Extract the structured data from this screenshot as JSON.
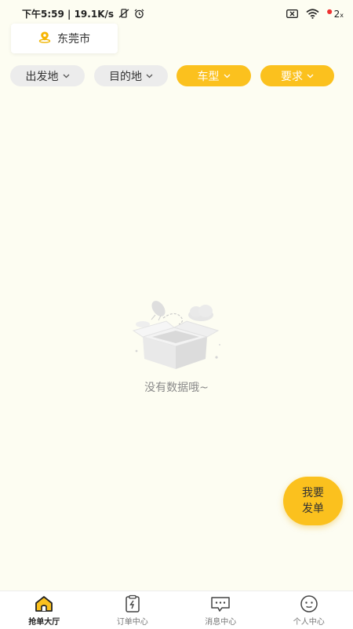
{
  "status_bar": {
    "time_speed": "下午5:59 | 19.1K/s",
    "battery": "2",
    "battery_unit": "x"
  },
  "location": {
    "city": "东莞市",
    "icon": "location-pin-icon"
  },
  "filters": [
    {
      "label": "出发地",
      "style": "grey"
    },
    {
      "label": "目的地",
      "style": "grey"
    },
    {
      "label": "车型",
      "style": "yellow"
    },
    {
      "label": "要求",
      "style": "yellow"
    }
  ],
  "empty_state": {
    "text": "没有数据哦~",
    "icon": "empty-box-illustration"
  },
  "fab": {
    "line1": "我要",
    "line2": "发单"
  },
  "tabbar": {
    "items": [
      {
        "label": "抢单大厅",
        "icon": "home-icon",
        "active": true
      },
      {
        "label": "订单中心",
        "icon": "clipboard-icon",
        "active": false
      },
      {
        "label": "消息中心",
        "icon": "chat-icon",
        "active": false
      },
      {
        "label": "个人中心",
        "icon": "user-face-icon",
        "active": false
      }
    ]
  },
  "colors": {
    "background": "#fdfdf2",
    "accent": "#fbc11e",
    "chip_grey": "#ececec"
  }
}
